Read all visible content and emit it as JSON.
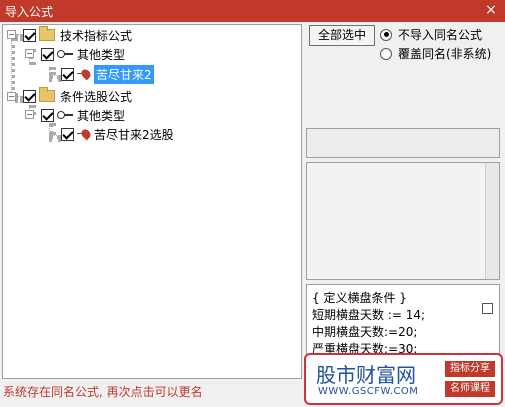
{
  "window": {
    "title": "导入公式",
    "close_glyph": "×"
  },
  "tree": {
    "nodes": [
      {
        "label": "技术指标公式"
      },
      {
        "label": "其他类型"
      },
      {
        "label": "苦尽甘来2"
      },
      {
        "label": "条件选股公式"
      },
      {
        "label": "其他类型"
      },
      {
        "label": "苦尽甘来2选股"
      }
    ]
  },
  "options": {
    "select_all": "全部选中",
    "radio_skip": "不导入同名公式",
    "radio_overwrite": "覆盖同名(非系统)"
  },
  "formula": {
    "lines": [
      "{ 定义横盘条件 }",
      "短期横盘天数 :=  14;",
      "中期横盘天数:=20;",
      "严重横盘天数:=30;"
    ]
  },
  "status_text": "系统存在同名公式, 再次点击可以更名",
  "watermark": {
    "brand": "股市财富网",
    "url": "WWW.GSCFW.COM",
    "tag1": "指标分享",
    "tag2": "名师课程"
  },
  "colors": {
    "titlebar": "#c0392b",
    "selection": "#3399ff",
    "status": "#c0392b"
  }
}
